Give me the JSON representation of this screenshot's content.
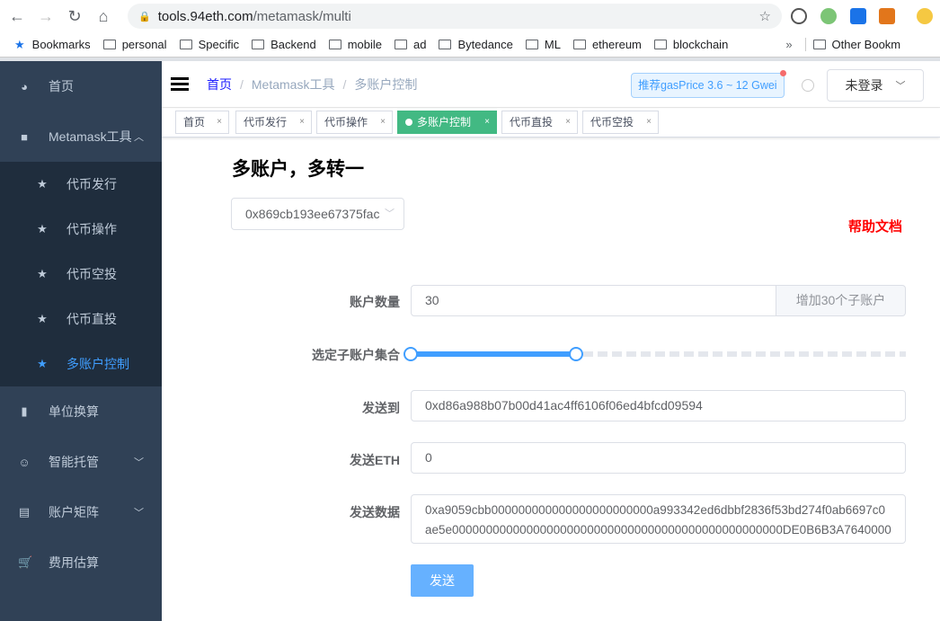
{
  "browser": {
    "url_host": "tools.94eth.com",
    "url_path": "/metamask/multi",
    "bookmarks": [
      "Bookmarks",
      "personal",
      "Specific",
      "Backend",
      "mobile",
      "ad",
      "Bytedance",
      "ML",
      "ethereum",
      "blockchain"
    ],
    "other_bookmarks": "Other Bookm",
    "overflow": "»"
  },
  "sidebar": {
    "items": [
      {
        "label": "首页",
        "icon": "dashboard-icon"
      },
      {
        "label": "Metamask工具",
        "icon": "lock-icon"
      },
      {
        "label": "代币发行",
        "icon": "star-icon"
      },
      {
        "label": "代币操作",
        "icon": "star-icon"
      },
      {
        "label": "代币空投",
        "icon": "star-icon"
      },
      {
        "label": "代币直投",
        "icon": "star-icon"
      },
      {
        "label": "多账户控制",
        "icon": "star-icon"
      },
      {
        "label": "单位换算",
        "icon": "chart-icon"
      },
      {
        "label": "智能托管",
        "icon": "robot-icon"
      },
      {
        "label": "账户矩阵",
        "icon": "table-icon"
      },
      {
        "label": "费用估算",
        "icon": "cart-icon"
      }
    ]
  },
  "header": {
    "breadcrumb": [
      "首页",
      "Metamask工具",
      "多账户控制"
    ],
    "gas": "推荐gasPrice 3.6 ~ 12 Gwei",
    "login": "未登录"
  },
  "tags": [
    {
      "label": "首页"
    },
    {
      "label": "代币发行"
    },
    {
      "label": "代币操作"
    },
    {
      "label": "多账户控制"
    },
    {
      "label": "代币直投"
    },
    {
      "label": "代币空投"
    }
  ],
  "main": {
    "title": "多账户，多转一",
    "account_select": "0x869cb193ee67375fac",
    "help": "帮助文档",
    "count_label": "账户数量",
    "count_value": "30",
    "add_button": "增加30个子账户",
    "range_label": "选定子账户集合",
    "range": {
      "min": 0,
      "max": 30,
      "from": 0,
      "to": 10
    },
    "to_label": "发送到",
    "to_value": "0xd86a988b07b00d41ac4ff6106f06ed4bfcd09594",
    "eth_label": "发送ETH",
    "eth_value": "0",
    "data_label": "发送数据",
    "data_value": "0xa9059cbb000000000000000000000000a993342ed6dbbf2836f53bd274f0ab6697c0ae5e0000000000000000000000000000000000000000000000000DE0B6B3A7640000",
    "send": "发送"
  },
  "colors": {
    "accent": "#409eff",
    "active_tag": "#42b983",
    "sidebar": "#304156",
    "help": "#ff0000"
  }
}
